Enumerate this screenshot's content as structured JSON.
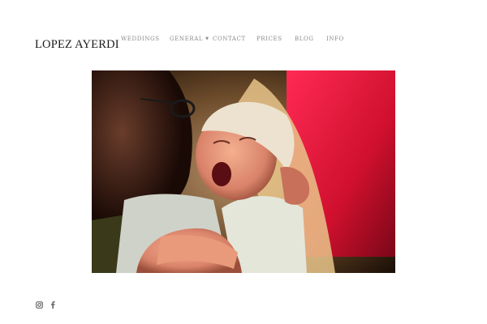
{
  "site": {
    "brand": "LOPEZ AYERDI"
  },
  "nav": {
    "items": [
      {
        "label": "WEDDINGS"
      },
      {
        "label": "GENERAL",
        "has_dropdown": true
      },
      {
        "label": "CONTACT"
      },
      {
        "label": "PRICES"
      },
      {
        "label": "BLOG"
      },
      {
        "label": "INFO"
      }
    ]
  },
  "hero": {
    "icon": "photo-newborn-yawning"
  },
  "social": {
    "icons": [
      "instagram-icon",
      "facebook-icon"
    ]
  },
  "colors": {
    "brand_text": "#1a1a1a",
    "nav_text": "#8a8a8a",
    "background": "#ffffff"
  }
}
